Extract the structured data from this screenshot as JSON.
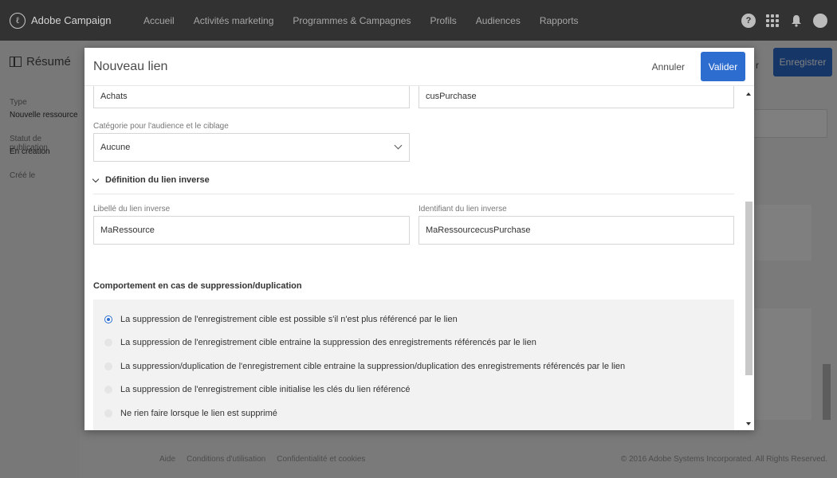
{
  "app": {
    "name": "Adobe Campaign",
    "nav": [
      "Accueil",
      "Activités marketing",
      "Programmes & Campagnes",
      "Profils",
      "Audiences",
      "Rapports"
    ],
    "icons": [
      "help-icon",
      "apps-grid-icon",
      "notifications-bell-icon",
      "user-avatar-icon"
    ]
  },
  "background": {
    "title": "Résumé",
    "type_label": "Type",
    "type_value": "Nouvelle ressource",
    "status_label": "Statut de publication",
    "status_value": "En création",
    "created_label": "Créé le",
    "cancel_peek": "r",
    "save_label": "Enregistrer",
    "footer_links": [
      "Aide",
      "Conditions d'utilisation",
      "Confidentialité et cookies"
    ],
    "copyright": "© 2016 Adobe Systems Incorporated. All Rights Reserved."
  },
  "modal": {
    "title": "Nouveau lien",
    "cancel_label": "Annuler",
    "validate_label": "Valider",
    "field_label_value": "Achats",
    "field_id_value": "cusPurchase",
    "category_label": "Catégorie pour l'audience et le ciblage",
    "category_value": "Aucune",
    "inverse_section_label": "Définition du lien inverse",
    "inverse_label_label": "Libellé du lien inverse",
    "inverse_label_value": "MaRessource",
    "inverse_id_label": "Identifiant du lien inverse",
    "inverse_id_value": "MaRessourcecusPurchase",
    "behavior_title": "Comportement en cas de suppression/duplication",
    "behavior_options": [
      "La suppression de l'enregistrement cible est possible s'il n'est plus référencé par le lien",
      "La suppression de l'enregistrement cible entraine la suppression des enregistrements référencés par le lien",
      "La suppression/duplication de l'enregistrement cible entraine la suppression/duplication des enregistrements référencés par le lien",
      "La suppression de l'enregistrement cible initialise les clés du lien référencé",
      "Ne rien faire lorsque le lien est supprimé"
    ],
    "behavior_selected_index": 0
  },
  "colors": {
    "accent": "#2d6dd0",
    "topbar": "#323232"
  }
}
